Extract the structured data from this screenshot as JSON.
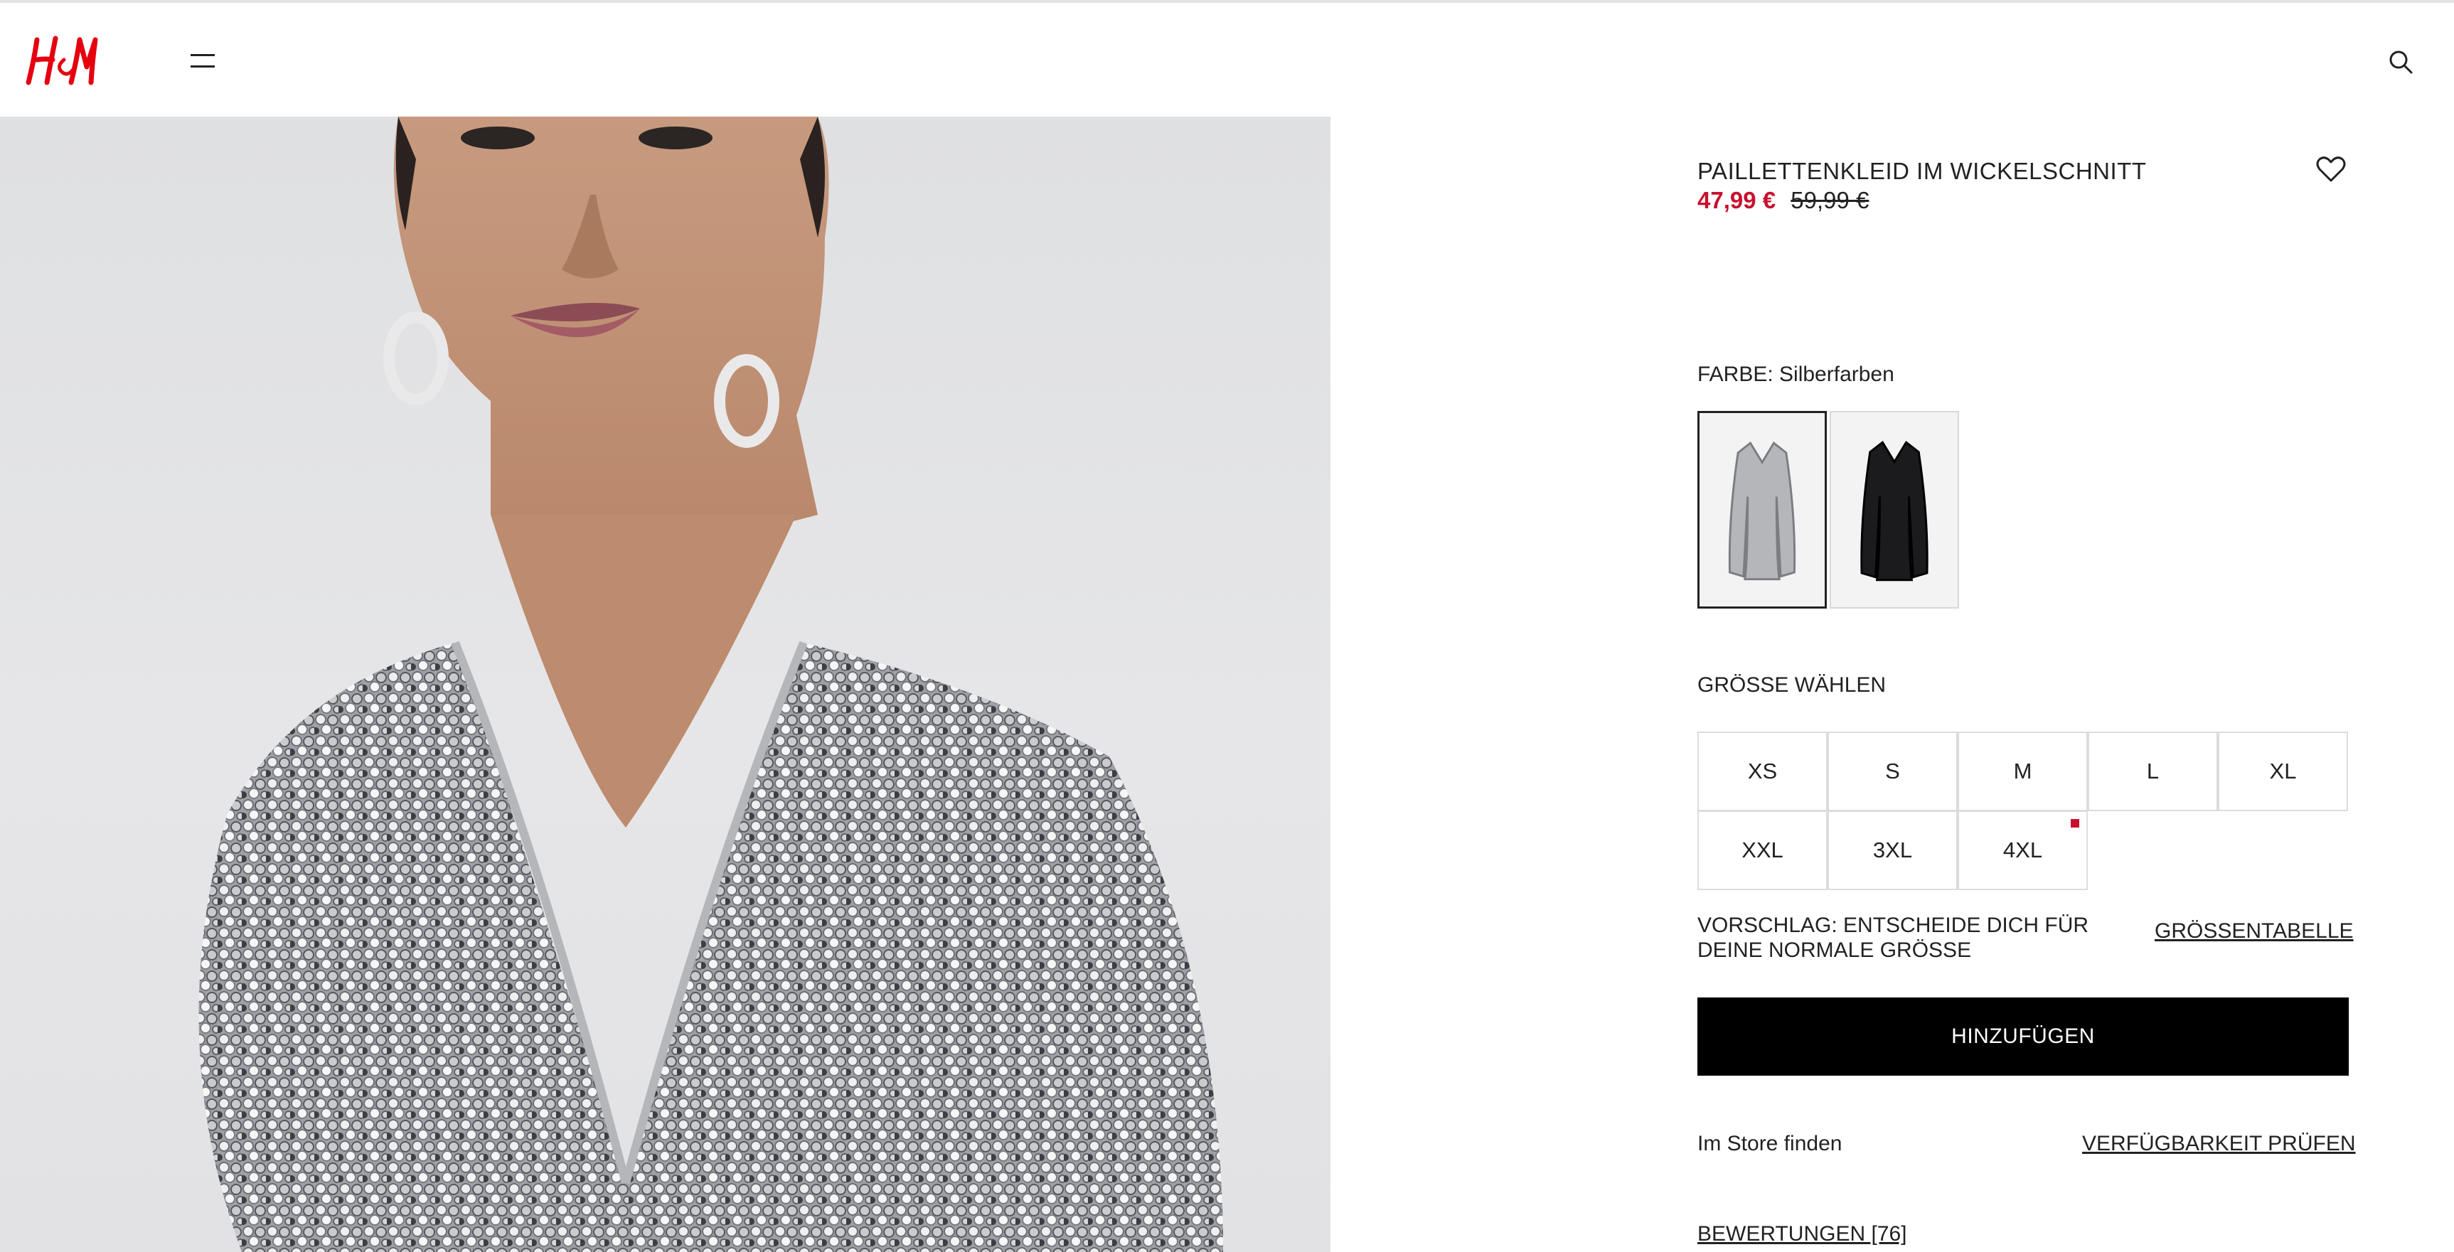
{
  "header": {
    "logo_text": "H&M",
    "brand_color": "#e50010",
    "menu_icon": "hamburger-menu-icon",
    "search_icon": "search-icon"
  },
  "product": {
    "title": "PAILLETTENKLEID IM WICKELSCHNITT",
    "price_sale": "47,99 €",
    "price_original": "59,99 €",
    "sale_color": "#c8102e",
    "favorite_icon": "heart-icon"
  },
  "color": {
    "label": "FARBE: Silberfarben",
    "options": [
      {
        "name": "silver-dress-swatch",
        "selected": true
      },
      {
        "name": "black-dress-swatch",
        "selected": false
      }
    ]
  },
  "size": {
    "label": "GRÖSSE WÄHLEN",
    "options": [
      "XS",
      "S",
      "M",
      "L",
      "XL",
      "XXL",
      "3XL",
      "4XL"
    ],
    "low_stock": [
      "4XL"
    ]
  },
  "fit": {
    "suggestion": "VORSCHLAG: ENTSCHEIDE DICH FÜR DEINE NORMALE GRÖSSE",
    "size_chart_link": "GRÖSSENTABELLE"
  },
  "cart": {
    "add_label": "HINZUFÜGEN"
  },
  "store": {
    "label": "Im Store finden",
    "availability_link": "VERFÜGBARKEIT PRÜFEN"
  },
  "reviews": {
    "link": "BEWERTUNGEN [76]"
  }
}
